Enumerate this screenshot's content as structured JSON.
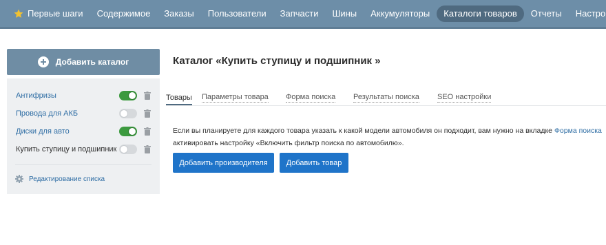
{
  "colors": {
    "nav_bg": "#6d8ea8",
    "nav_active_bg": "#4f6a80",
    "primary_button": "#1f74c9",
    "toggle_on": "#3c9a3f",
    "link": "#2e6da4"
  },
  "nav": {
    "items": [
      {
        "label": "Первые шаги",
        "icon": "star-icon"
      },
      {
        "label": "Содержимое"
      },
      {
        "label": "Заказы"
      },
      {
        "label": "Пользователи"
      },
      {
        "label": "Запчасти"
      },
      {
        "label": "Шины"
      },
      {
        "label": "Аккумуляторы"
      },
      {
        "label": "Каталоги товаров",
        "active": true
      },
      {
        "label": "Отчеты"
      },
      {
        "label": "Настройки"
      }
    ]
  },
  "sidebar": {
    "add_button_label": "Добавить каталог",
    "catalogs": [
      {
        "name": "Антифризы",
        "enabled": true
      },
      {
        "name": "Провода для АКБ",
        "enabled": false
      },
      {
        "name": "Диски для авто",
        "enabled": true
      },
      {
        "name": "Купить ступицу и подшипник",
        "enabled": false,
        "current": true
      }
    ],
    "edit_list_label": "Редактирование списка"
  },
  "main": {
    "title": "Каталог «Купить ступицу и подшипник »",
    "tabs": [
      {
        "label": "Товары",
        "active": true
      },
      {
        "label": "Параметры товара"
      },
      {
        "label": "Форма поиска"
      },
      {
        "label": "Результаты поиска"
      },
      {
        "label": "SEO настройки"
      }
    ],
    "info": {
      "text_before_link": "Если вы планируете для каждого товара указать к какой модели автомобиля он подходит, вам нужно на вкладке ",
      "link": "Форма поиска",
      "text_after_link": "активировать настройку «Включить фильтр поиска по автомобилю»."
    },
    "buttons": {
      "add_manufacturer": "Добавить производителя",
      "add_product": "Добавить товар"
    }
  }
}
